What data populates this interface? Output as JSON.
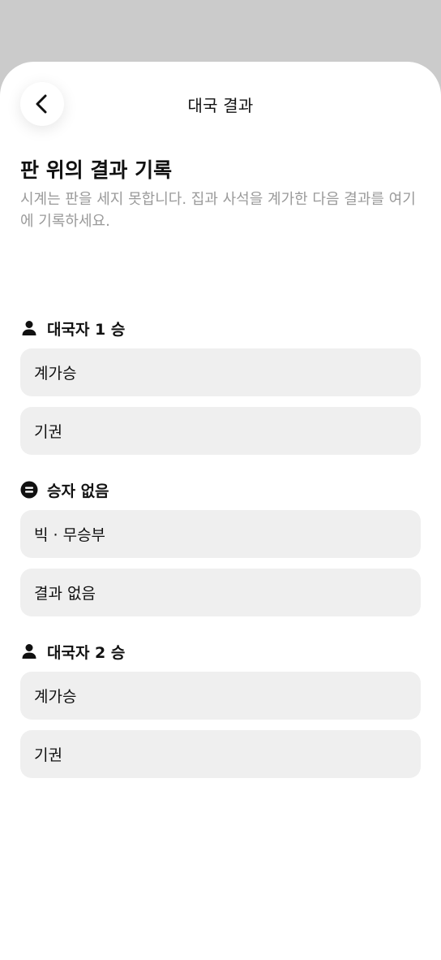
{
  "header": {
    "title": "대국 결과",
    "back_icon": "chevron-left-icon"
  },
  "intro": {
    "title": "판 위의 결과 기록",
    "description": "시계는 판을 세지 못합니다. 집과 사석을 계가한 다음 결과를 여기에 기록하세요."
  },
  "groups": [
    {
      "label": "대국자 1 승",
      "icon": "person-icon",
      "options": [
        "계가승",
        "기권"
      ]
    },
    {
      "label": "승자 없음",
      "icon": "equals-circle-icon",
      "options": [
        "빅 · 무승부",
        "결과 없음"
      ]
    },
    {
      "label": "대국자 2 승",
      "icon": "person-icon",
      "options": [
        "계가승",
        "기권"
      ]
    }
  ],
  "colors": {
    "backdrop": "#cbcbcb",
    "sheet": "#ffffff",
    "option_bg": "#efefef",
    "muted_text": "#9a9a9a",
    "text": "#111111"
  }
}
